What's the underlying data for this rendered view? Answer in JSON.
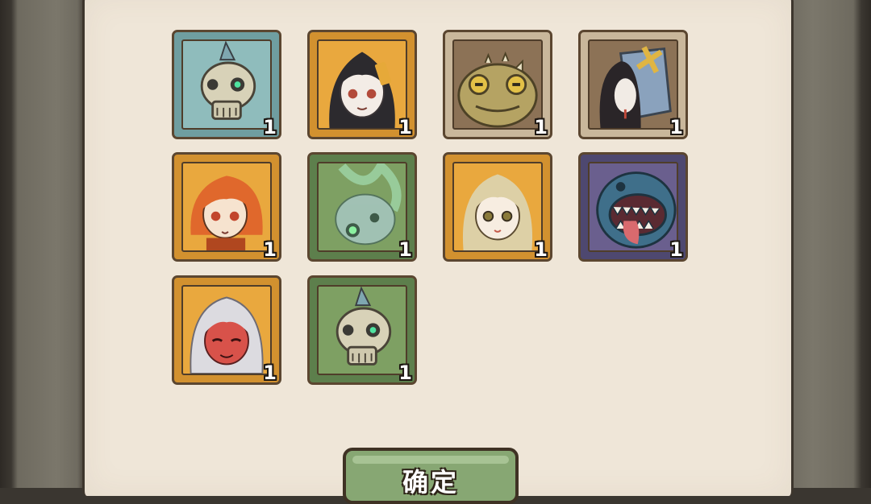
{
  "items": [
    {
      "name": "skull-with-spike",
      "rarity": "blue",
      "count": "1"
    },
    {
      "name": "black-hair-girl",
      "rarity": "orange",
      "count": "1"
    },
    {
      "name": "toad",
      "rarity": "beige",
      "count": "1"
    },
    {
      "name": "box-head-ghost",
      "rarity": "beige",
      "count": "1"
    },
    {
      "name": "orange-hair-girl",
      "rarity": "orange",
      "count": "1"
    },
    {
      "name": "green-ghost",
      "rarity": "green",
      "count": "1"
    },
    {
      "name": "blonde-girl",
      "rarity": "orange",
      "count": "1"
    },
    {
      "name": "fish-monster",
      "rarity": "purple",
      "count": "1"
    },
    {
      "name": "red-skin-girl",
      "rarity": "orange",
      "count": "1"
    },
    {
      "name": "skull-with-spike",
      "rarity": "green",
      "count": "1"
    }
  ],
  "confirm_label": "确定",
  "colors": {
    "paper": "#efe6d8",
    "button": "#87a773",
    "border": "#5b4630"
  }
}
